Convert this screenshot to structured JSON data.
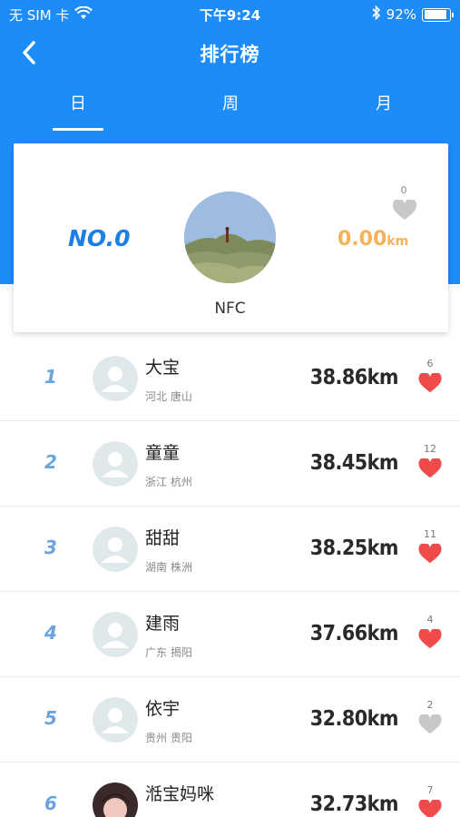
{
  "status_bar": {
    "carrier": "无 SIM 卡",
    "time": "下午9:24",
    "battery_percent": "92%",
    "battery_level": 0.92
  },
  "nav": {
    "title": "排行榜"
  },
  "tabs": [
    {
      "label": "日",
      "selected": true
    },
    {
      "label": "周",
      "selected": false
    },
    {
      "label": "月",
      "selected": false
    }
  ],
  "me": {
    "rank": "NO.0",
    "name": "NFC",
    "distance_value": "0.00",
    "distance_unit": "km",
    "like_count": "0",
    "liked": false
  },
  "leaderboard": [
    {
      "rank": "1",
      "name": "大宝",
      "location": "河北  唐山",
      "distance": "38.86km",
      "likes": "6",
      "liked": true,
      "avatar": "default"
    },
    {
      "rank": "2",
      "name": "童童",
      "location": "浙江  杭州",
      "distance": "38.45km",
      "likes": "12",
      "liked": true,
      "avatar": "default"
    },
    {
      "rank": "3",
      "name": "甜甜",
      "location": "湖南  株洲",
      "distance": "38.25km",
      "likes": "11",
      "liked": true,
      "avatar": "default"
    },
    {
      "rank": "4",
      "name": "建雨",
      "location": "广东  揭阳",
      "distance": "37.66km",
      "likes": "4",
      "liked": true,
      "avatar": "default"
    },
    {
      "rank": "5",
      "name": "依宇",
      "location": "贵州  贵阳",
      "distance": "32.80km",
      "likes": "2",
      "liked": false,
      "avatar": "default"
    },
    {
      "rank": "6",
      "name": "湉宝妈咪",
      "location": "",
      "distance": "32.73km",
      "likes": "7",
      "liked": true,
      "avatar": "photo"
    }
  ],
  "colors": {
    "header_blue": "#1d8cf8",
    "rank_blue": "#6ba3dd",
    "distance_orange": "#f5b25a",
    "heart_red": "#f04a4a",
    "heart_gray": "#c8c8c8"
  }
}
